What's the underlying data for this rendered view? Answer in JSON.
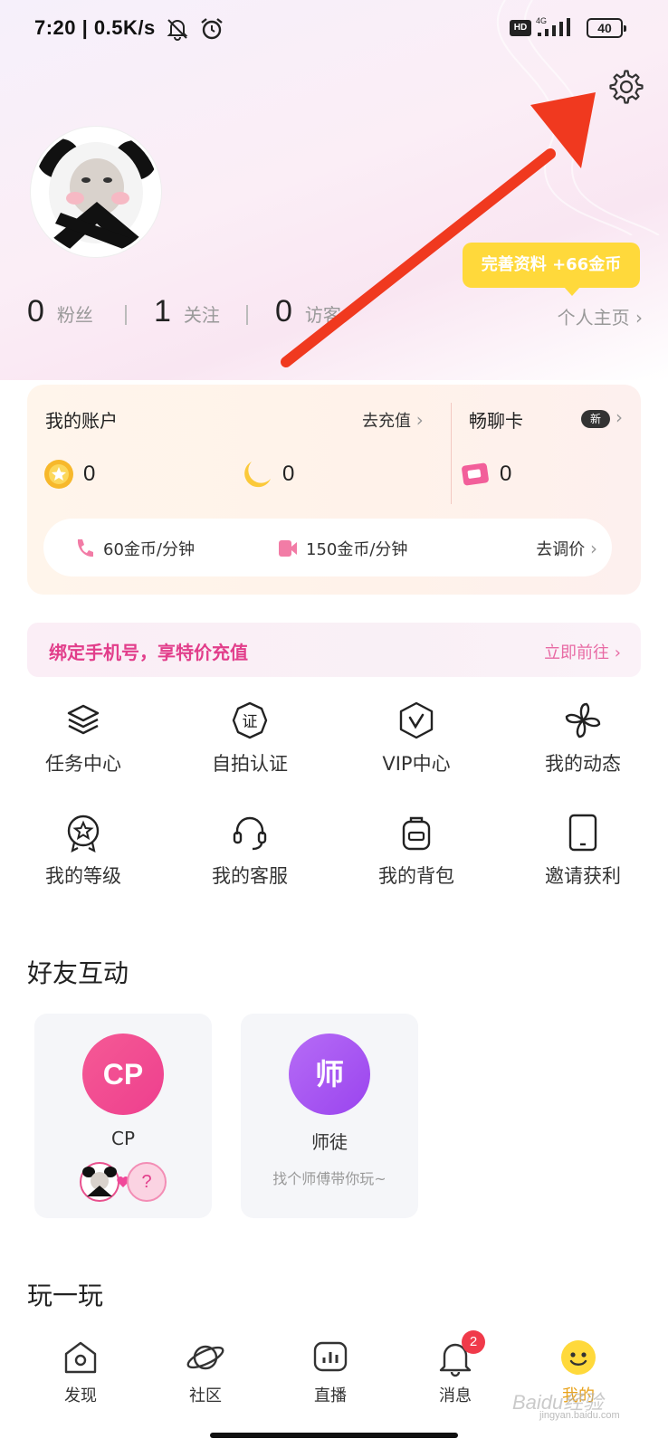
{
  "status_bar": {
    "time": "7:20 | 0.5K/s",
    "hd": "HD",
    "network": "4G",
    "battery": "40"
  },
  "profile": {
    "complete_tip": "完善资料 +66金币",
    "stats": [
      {
        "value": "0",
        "label": "粉丝"
      },
      {
        "value": "1",
        "label": "关注"
      },
      {
        "value": "0",
        "label": "访客"
      }
    ],
    "homepage_link": "个人主页"
  },
  "account": {
    "title": "我的账户",
    "recharge": "去充值",
    "coins_balance": "0",
    "moon_balance": "0",
    "chat_card_title": "畅聊卡",
    "new_badge": "新",
    "chat_card_balance": "0",
    "voice_rate": "60金币/分钟",
    "video_rate": "150金币/分钟",
    "adjust_price": "去调价"
  },
  "bind_banner": {
    "text": "绑定手机号，享特价充值",
    "action": "立即前往"
  },
  "grid": {
    "task_center": "任务中心",
    "selfie_verify": "自拍认证",
    "vip_center": "VIP中心",
    "my_moments": "我的动态",
    "my_level": "我的等级",
    "my_service": "我的客服",
    "my_backpack": "我的背包",
    "invite_earn": "邀请获利"
  },
  "friends": {
    "title": "好友互动",
    "cp": {
      "icon_text": "CP",
      "name": "CP",
      "unknown": "?"
    },
    "mentor": {
      "icon_text": "师",
      "name": "师徒",
      "sub": "找个师傅带你玩~"
    }
  },
  "play": {
    "title": "玩一玩"
  },
  "tabs": {
    "discover": "发现",
    "community": "社区",
    "live": "直播",
    "messages": "消息",
    "messages_badge": "2",
    "mine": "我的"
  },
  "watermark": {
    "brand": "Baidu经验",
    "url": "jingyan.baidu.com"
  },
  "colors": {
    "accent_pink": "#e23e8b",
    "arrow_red": "#f0391f",
    "tip_yellow": "#ffd93b",
    "cp_pink": "#f0489a",
    "mentor_purple": "#a653f0"
  }
}
